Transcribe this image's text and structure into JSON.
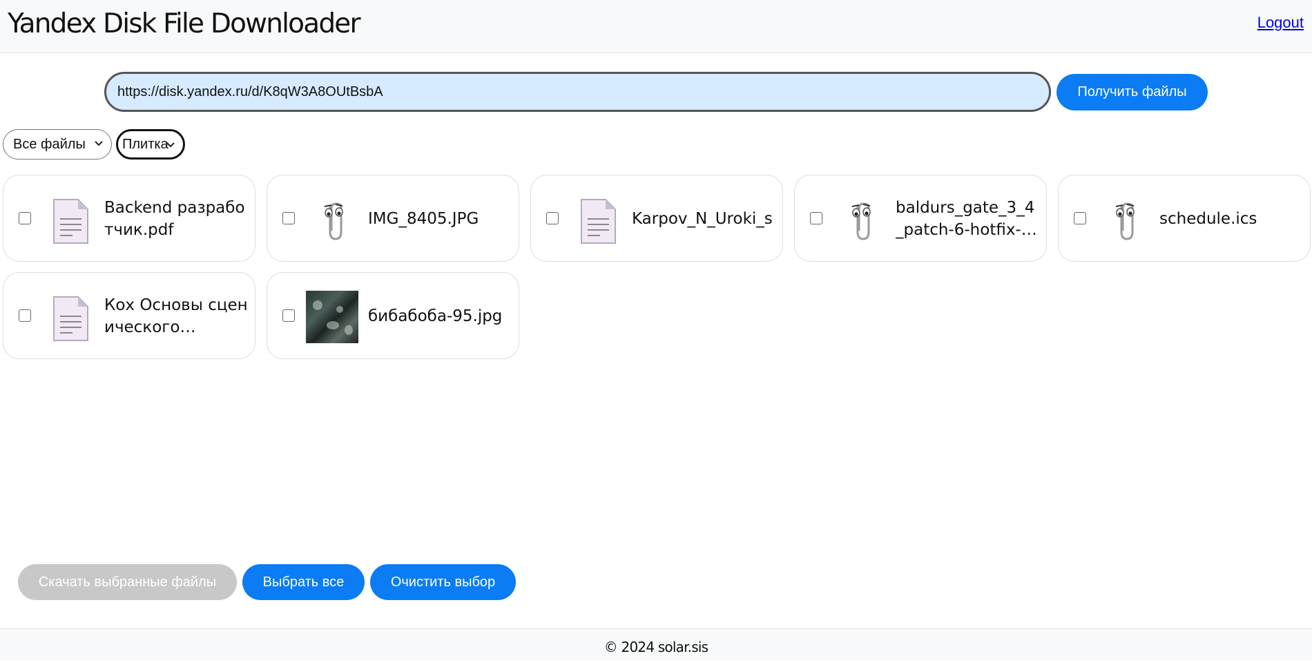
{
  "header": {
    "title": "Yandex Disk File Downloader",
    "logout_label": "Logout"
  },
  "search": {
    "url_value": "https://disk.yandex.ru/d/K8qW3A8OUtBsbA",
    "submit_label": "Получить файлы"
  },
  "filters": {
    "type_selected": "Все файлы",
    "view_selected": "Плитка"
  },
  "files": [
    {
      "name": "Backend разработчик.pdf",
      "icon": "document-icon"
    },
    {
      "name": "IMG_8405.JPG",
      "icon": "clippy-paperclip-icon"
    },
    {
      "name": "Karpov_N_Uroki_s",
      "icon": "document-icon"
    },
    {
      "name": "baldurs_gate_3_4_patch-6-hotfix-…",
      "icon": "clippy-paperclip-icon"
    },
    {
      "name": "schedule.ics",
      "icon": "clippy-paperclip-icon"
    },
    {
      "name": "Кох Основы сценического…",
      "icon": "document-icon"
    },
    {
      "name": "бибабоба-95.jpg",
      "icon": "image-thumbnail"
    }
  ],
  "actions": {
    "download_label": "Скачать выбранные файлы",
    "select_all_label": "Выбрать все",
    "clear_label": "Очистить выбор"
  },
  "footer": {
    "copyright": "© 2024 solar.sis"
  },
  "colors": {
    "accent": "#0b7cf4",
    "disabled": "#c8c8c8",
    "input_bg": "#d6ebff"
  }
}
